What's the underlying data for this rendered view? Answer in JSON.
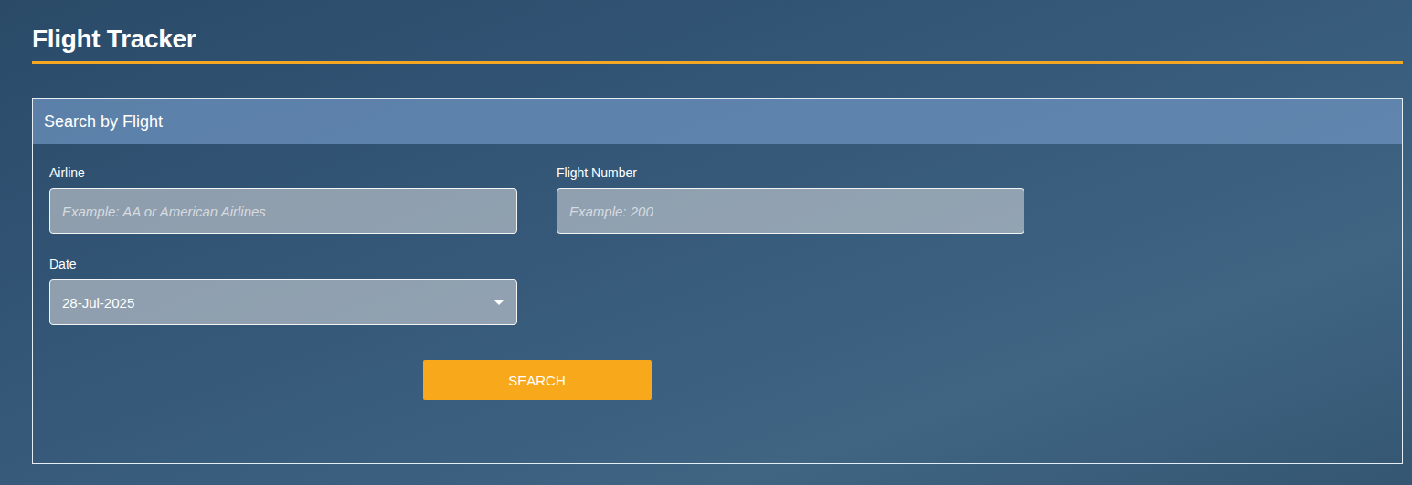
{
  "page": {
    "title": "Flight Tracker"
  },
  "panel": {
    "title": "Search by Flight"
  },
  "fields": [
    {
      "label": "Airline",
      "kind": "text",
      "placeholder": "Example: AA or American Airlines",
      "value": ""
    },
    {
      "label": "Flight Number",
      "kind": "text",
      "placeholder": "Example: 200",
      "value": ""
    },
    {
      "label": "Date",
      "kind": "select",
      "placeholder": "",
      "value": "28-Jul-2025"
    }
  ],
  "button": {
    "label": "SEARCH"
  }
}
